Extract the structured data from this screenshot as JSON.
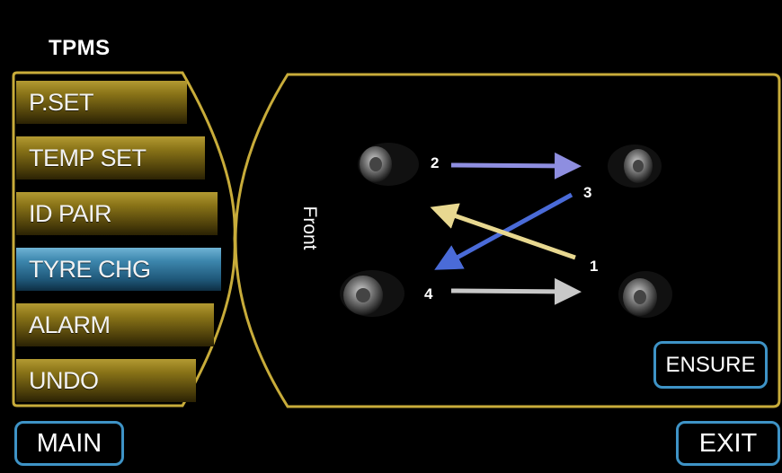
{
  "header": {
    "title": "TPMS"
  },
  "menu": {
    "items": [
      {
        "label": "P.SET",
        "active": false
      },
      {
        "label": "TEMP SET",
        "active": false
      },
      {
        "label": "ID PAIR",
        "active": false
      },
      {
        "label": "TYRE CHG",
        "active": true
      },
      {
        "label": "ALARM",
        "active": false
      },
      {
        "label": "UNDO",
        "active": false
      }
    ]
  },
  "diagram": {
    "front_label": "Front",
    "positions": [
      "1",
      "2",
      "3",
      "4"
    ],
    "arrow_colors": {
      "2_to_right": "#8e8ee0",
      "3_to_4": "#4a6bd8",
      "1_to_front": "#e8d890",
      "4_to_right": "#c8c8c8"
    }
  },
  "buttons": {
    "ensure": "ENSURE",
    "main": "MAIN",
    "exit": "EXIT"
  },
  "colors": {
    "accent_gold": "#c8ac3a",
    "accent_blue": "#3e93c6",
    "background": "#000000"
  }
}
